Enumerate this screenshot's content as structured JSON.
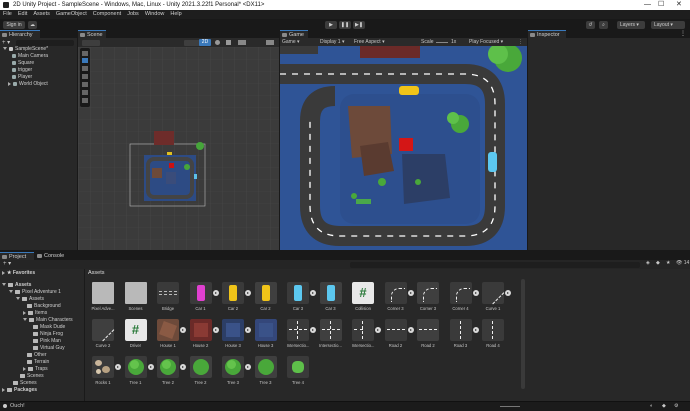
{
  "window": {
    "title": "2D Unity Project - SampleScene - Windows, Mac, Linux - Unity 2021.3.22f1 Personal* <DX11>",
    "controls": [
      "—",
      "☐",
      "✕"
    ]
  },
  "menu": [
    "File",
    "Edit",
    "Assets",
    "GameObject",
    "Component",
    "Jobs",
    "Window",
    "Help"
  ],
  "toolbar": {
    "sign_in": "Sign in",
    "layers": "Layers",
    "layout": "Layout"
  },
  "hierarchy": {
    "tab": "Hierarchy",
    "scene": "SampleScene*",
    "items": [
      "Main Camera",
      "Square",
      "trigger",
      "Player",
      "World Object"
    ]
  },
  "scene_view": {
    "tab": "Scene",
    "mode_2d": "2D"
  },
  "game_view": {
    "tab": "Game",
    "mode": "Game",
    "display": "Display 1",
    "aspect": "Free Aspect",
    "scale_label": "Scale",
    "scale_value": "1x",
    "play_focused": "Play Focused"
  },
  "inspector": {
    "tab": "Inspector"
  },
  "project": {
    "tab_project": "Project",
    "tab_console": "Console",
    "favorites": "Favorites",
    "tree": {
      "assets": "Assets",
      "pixel_adventure": "Pixel Adventure 1",
      "pa_assets": "Assets",
      "background": "Background",
      "items": "Items",
      "main_characters": "Main Characters",
      "mask_dude": "Mask Dude",
      "ninja_frog": "Ninja Frog",
      "pink_man": "Pink Man",
      "virtual_guy": "Virtual Guy",
      "other": "Other",
      "terrain": "Terrain",
      "traps": "Traps",
      "scenes": "Scenes",
      "root_scenes": "Scenes",
      "packages": "Packages"
    },
    "breadcrumb": "Assets",
    "assets": [
      {
        "label": "Pixel Adve...",
        "kind": "folder"
      },
      {
        "label": "Scenes",
        "kind": "folder"
      },
      {
        "label": "Bridge",
        "kind": "bridge"
      },
      {
        "label": "Car 1",
        "kind": "car-pink",
        "expand": true
      },
      {
        "label": "Car 2",
        "kind": "car-yellow",
        "expand": true
      },
      {
        "label": "Car 2",
        "kind": "car-yellow-sheet"
      },
      {
        "label": "Car 3",
        "kind": "car-blue",
        "expand": true
      },
      {
        "label": "Car 3",
        "kind": "car-blue-sheet"
      },
      {
        "label": "Collision",
        "kind": "script"
      },
      {
        "label": "Corner 3",
        "kind": "corner",
        "expand": true
      },
      {
        "label": "Corner 3",
        "kind": "corner-sheet"
      },
      {
        "label": "Corner 4",
        "kind": "corner",
        "expand": true
      },
      {
        "label": "Curve 1",
        "kind": "curve",
        "expand": true
      },
      {
        "label": "Curve 2",
        "kind": "curve-sheet"
      },
      {
        "label": "Driver",
        "kind": "script"
      },
      {
        "label": "House 1",
        "kind": "house-brown",
        "expand": true
      },
      {
        "label": "House 2",
        "kind": "house-red",
        "expand": true
      },
      {
        "label": "House 3",
        "kind": "house-blue",
        "expand": true
      },
      {
        "label": "House 3",
        "kind": "house-blue-sheet"
      },
      {
        "label": "Intersectio...",
        "kind": "intersection",
        "expand": true
      },
      {
        "label": "Intersectio...",
        "kind": "intersection-sheet"
      },
      {
        "label": "Intersectio...",
        "kind": "intersection2",
        "expand": true
      },
      {
        "label": "Road 2",
        "kind": "road",
        "expand": true
      },
      {
        "label": "Road 2",
        "kind": "road-sheet"
      },
      {
        "label": "Road 3",
        "kind": "road-v",
        "expand": true
      },
      {
        "label": "Road 4",
        "kind": "road-v"
      },
      {
        "label": "Rocks 1",
        "kind": "rocks",
        "expand": true
      },
      {
        "label": "Tree 1",
        "kind": "tree",
        "expand": true
      },
      {
        "label": "Tree 2",
        "kind": "tree",
        "expand": true
      },
      {
        "label": "Tree 2",
        "kind": "tree-sheet"
      },
      {
        "label": "Tree 3",
        "kind": "tree",
        "expand": true
      },
      {
        "label": "Tree 3",
        "kind": "tree-sheet"
      },
      {
        "label": "Tree 4",
        "kind": "tree-small"
      }
    ],
    "item_count": "14"
  },
  "status": {
    "message": "Ouch!"
  },
  "colors": {
    "accent": "#3a79bb",
    "road": "#3a3a3a",
    "water": "#2f5496",
    "grass": "#4aa83a"
  }
}
